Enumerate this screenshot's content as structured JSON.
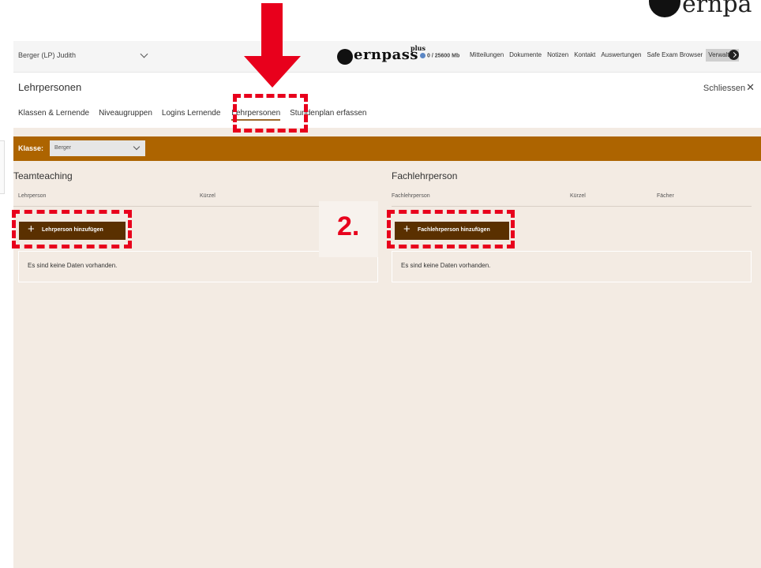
{
  "corner": {
    "text": "ernpa"
  },
  "topbar": {
    "user": "Berger (LP) Judith",
    "brand": {
      "name": "ernpass",
      "plus": "plus"
    },
    "storage": "0 / 25600 Mb",
    "nav": [
      "Mitteilungen",
      "Dokumente",
      "Notizen",
      "Kontakt",
      "Auswertungen",
      "Safe Exam Browser",
      "Verwalten"
    ],
    "active_nav": "Verwalten"
  },
  "panel": {
    "title": "Lehrpersonen",
    "close_label": "Schliessen",
    "close_symbol": "✕",
    "tabs": [
      "Klassen & Lernende",
      "Niveaugruppen",
      "Logins Lernende",
      "Lehrpersonen",
      "Stundenplan erfassen"
    ],
    "active_tab": "Lehrpersonen"
  },
  "class_filter": {
    "label": "Klasse:",
    "value": "Berger"
  },
  "teamteaching": {
    "title": "Teamteaching",
    "columns": [
      "Lehrperson",
      "Kürzel"
    ],
    "add_button": "Lehrperson hinzufügen",
    "empty_text": "Es sind keine Daten vorhanden."
  },
  "fachlehrperson": {
    "title": "Fachlehrperson",
    "columns": [
      "Fachlehrperson",
      "Kürzel",
      "Fächer"
    ],
    "add_button": "Fachlehrperson hinzufügen",
    "empty_text": "Es sind keine Daten vorhanden."
  },
  "annotation": {
    "step": "2.",
    "color": "#e8001c"
  },
  "icons": {
    "plus": "+",
    "logout": "logout-icon",
    "storage": "cloud-icon"
  },
  "colors": {
    "class_bar": "#ad6400",
    "button": "#5a3000",
    "background": "#f3ebe3"
  }
}
